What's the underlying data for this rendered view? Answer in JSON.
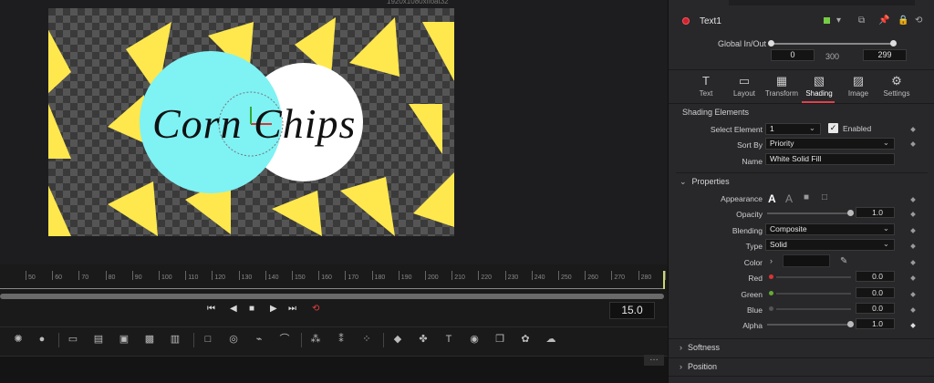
{
  "viewer": {
    "resolution": "1920x1080xfloat32",
    "title_text": "Corn Chips",
    "colors": {
      "circle_left": "#7ff2f4",
      "circle_right": "#ffffff",
      "triangles": "#ffe84d"
    }
  },
  "timeline": {
    "ruler_labels": [
      "50",
      "60",
      "70",
      "80",
      "90",
      "100",
      "110",
      "120",
      "130",
      "140",
      "150",
      "160",
      "170",
      "180",
      "190",
      "200",
      "210",
      "220",
      "230",
      "240",
      "250",
      "260",
      "270",
      "280",
      "290"
    ],
    "current_frame": "15.0"
  },
  "transport": {
    "buttons": [
      "skip-to-start-icon",
      "step-back-icon",
      "stop-icon",
      "play-icon",
      "skip-to-end-icon",
      "loop-icon"
    ]
  },
  "inspector": {
    "node_name": "Text1",
    "global_in_out": {
      "label": "Global In/Out",
      "start": "0",
      "mid": "300",
      "end": "299"
    },
    "tabs": [
      {
        "label": "Text",
        "icon": "T"
      },
      {
        "label": "Layout",
        "icon": "▭"
      },
      {
        "label": "Transform",
        "icon": "▦"
      },
      {
        "label": "Shading",
        "icon": "▧"
      },
      {
        "label": "Image",
        "icon": "▨"
      },
      {
        "label": "Settings",
        "icon": "⚙"
      }
    ],
    "active_tab": "Shading",
    "shading_elements": {
      "title": "Shading Elements",
      "select_label": "Select Element",
      "select_value": "1",
      "enabled_label": "Enabled",
      "sort_label": "Sort By",
      "sort_value": "Priority",
      "name_label": "Name",
      "name_value": "White Solid Fill"
    },
    "properties": {
      "title": "Properties",
      "appearance_label": "Appearance",
      "opacity_label": "Opacity",
      "opacity_value": "1.0",
      "blending_label": "Blending",
      "blending_value": "Composite",
      "type_label": "Type",
      "type_value": "Solid",
      "color_label": "Color",
      "red_label": "Red",
      "red_value": "0.0",
      "green_label": "Green",
      "green_value": "0.0",
      "blue_label": "Blue",
      "blue_value": "0.0",
      "alpha_label": "Alpha",
      "alpha_value": "1.0",
      "accent": "#e0414f"
    },
    "collapsed_sections": [
      "Softness",
      "Position"
    ]
  }
}
